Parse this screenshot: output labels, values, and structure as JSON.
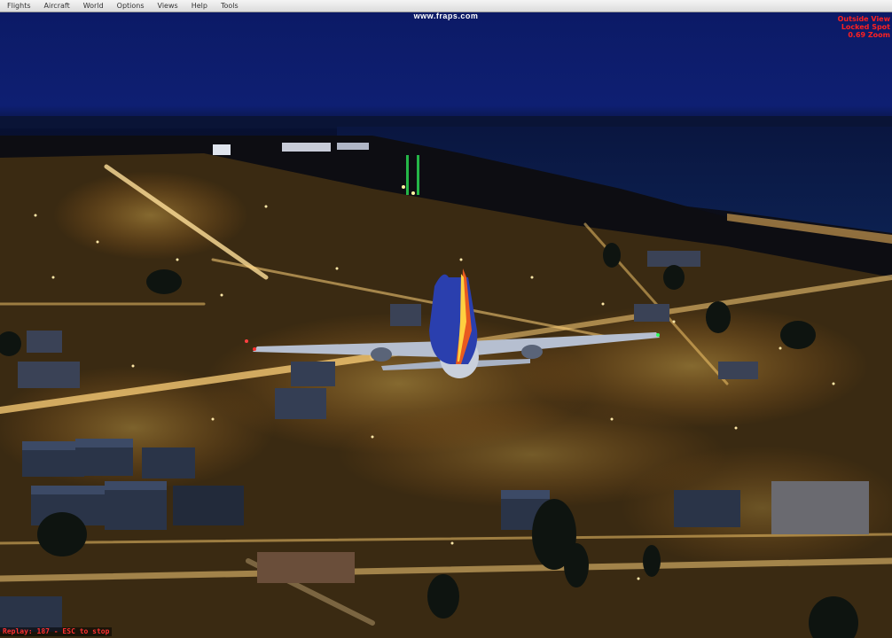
{
  "menu": {
    "items": [
      "Flights",
      "Aircraft",
      "World",
      "Options",
      "Views",
      "Help",
      "Tools"
    ]
  },
  "overlay": {
    "fraps": "www.fraps.com",
    "view_lines": [
      "Outside View",
      "Locked Spot",
      "0.69 Zoom"
    ],
    "replay": "Replay: 187 - ESC to stop"
  },
  "colors": {
    "sky": "#0e1f72",
    "sea": "#0a1a3e",
    "city_light": "#ffc040",
    "overlay_text": "#ff2020"
  }
}
